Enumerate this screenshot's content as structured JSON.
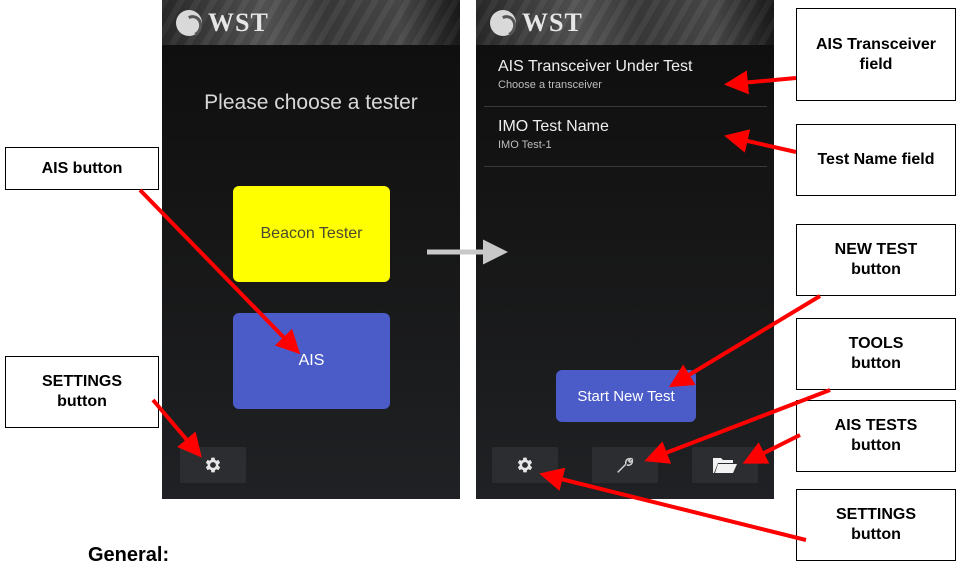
{
  "app": {
    "logo_text": "WST"
  },
  "left_screen": {
    "prompt": "Please choose a tester",
    "beacon_button_label": "Beacon Tester",
    "ais_button_label": "AIS",
    "settings_icon": "gear-icon"
  },
  "right_screen": {
    "fields": [
      {
        "title": "AIS Transceiver Under Test",
        "value": "Choose a transceiver"
      },
      {
        "title": "IMO Test Name",
        "value": "IMO Test-1"
      }
    ],
    "start_button_label": "Start New Test",
    "toolbar_icons": [
      "gear-icon",
      "wrench-icon",
      "folder-icon"
    ]
  },
  "callouts": {
    "ais_button": "AIS button",
    "settings_left": "SETTINGS button",
    "ais_transceiver": "AIS Transceiver field",
    "test_name": "Test Name field",
    "new_test": "NEW TEST button",
    "tools": "TOOLS button",
    "ais_tests": "AIS TESTS button",
    "settings_right": "SETTINGS button"
  },
  "caption": "General:",
  "colors": {
    "beacon_yellow": "#ffff00",
    "ais_blue": "#4b5cc8",
    "arrow_red": "#ff0000",
    "transition_arrow": "#c8c8c8"
  }
}
